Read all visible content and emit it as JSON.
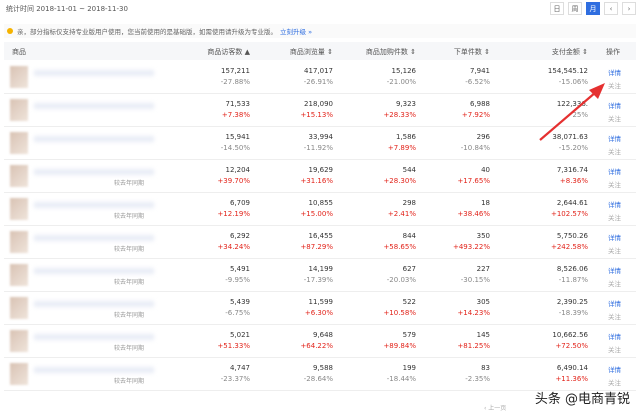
{
  "period": "统计时间 2018-11-01 ~ 2018-11-30",
  "period_tabs": [
    "日",
    "周",
    "月"
  ],
  "active_tab": "月",
  "notice": "亲，部分指标仅支持专业版用户使用，您当前使用的是基础版，如需使用请升级为专业版。",
  "notice_link": "立刻升级 »",
  "columns": [
    "商品",
    "商品访客数 ▲",
    "商品浏览量 ⇕",
    "商品加购件数 ⇕",
    "下单件数 ⇕",
    "支付金额 ⇕",
    "操作"
  ],
  "detail_label": "详情",
  "follow_label": "关注",
  "compare_label": "较去年同期",
  "rows": [
    {
      "cmp": "",
      "c": [
        [
          "157,211",
          "-27.88%"
        ],
        [
          "417,017",
          "-26.91%"
        ],
        [
          "15,126",
          "-21.00%"
        ],
        [
          "7,941",
          "-6.52%"
        ],
        [
          "154,545.12",
          "-15.06%"
        ]
      ]
    },
    {
      "cmp": "",
      "c": [
        [
          "71,533",
          "+7.38%"
        ],
        [
          "218,090",
          "+15.13%"
        ],
        [
          "9,323",
          "+28.33%"
        ],
        [
          "6,988",
          "+7.92%"
        ],
        [
          "122,336.",
          "25%"
        ]
      ]
    },
    {
      "cmp": "",
      "c": [
        [
          "15,941",
          "-14.50%"
        ],
        [
          "33,994",
          "-11.92%"
        ],
        [
          "1,586",
          "+7.89%"
        ],
        [
          "296",
          "-10.84%"
        ],
        [
          "38,071.63",
          "-15.20%"
        ]
      ]
    },
    {
      "cmp": "较去年同期",
      "c": [
        [
          "12,204",
          "+39.70%"
        ],
        [
          "19,629",
          "+31.16%"
        ],
        [
          "544",
          "+28.30%"
        ],
        [
          "40",
          "+17.65%"
        ],
        [
          "7,316.74",
          "+8.36%"
        ]
      ]
    },
    {
      "cmp": "较去年同期",
      "c": [
        [
          "6,709",
          "+12.19%"
        ],
        [
          "10,855",
          "+15.00%"
        ],
        [
          "298",
          "+2.41%"
        ],
        [
          "18",
          "+38.46%"
        ],
        [
          "2,644.61",
          "+102.57%"
        ]
      ]
    },
    {
      "cmp": "较去年同期",
      "c": [
        [
          "6,292",
          "+34.24%"
        ],
        [
          "16,455",
          "+87.29%"
        ],
        [
          "844",
          "+58.65%"
        ],
        [
          "350",
          "+493.22%"
        ],
        [
          "5,750.26",
          "+242.58%"
        ]
      ]
    },
    {
      "cmp": "较去年同期",
      "c": [
        [
          "5,491",
          "-9.95%"
        ],
        [
          "14,199",
          "-17.39%"
        ],
        [
          "627",
          "-20.03%"
        ],
        [
          "227",
          "-30.15%"
        ],
        [
          "8,526.06",
          "-11.87%"
        ]
      ]
    },
    {
      "cmp": "较去年同期",
      "c": [
        [
          "5,439",
          "-6.75%"
        ],
        [
          "11,599",
          "+6.30%"
        ],
        [
          "522",
          "+10.58%"
        ],
        [
          "305",
          "+14.23%"
        ],
        [
          "2,390.25",
          "-18.39%"
        ]
      ]
    },
    {
      "cmp": "较去年同期",
      "c": [
        [
          "5,021",
          "+51.33%"
        ],
        [
          "9,648",
          "+64.22%"
        ],
        [
          "579",
          "+89.84%"
        ],
        [
          "145",
          "+81.25%"
        ],
        [
          "10,662.56",
          "+72.50%"
        ]
      ]
    },
    {
      "cmp": "较去年同期",
      "c": [
        [
          "4,747",
          "-23.37%"
        ],
        [
          "9,588",
          "-28.64%"
        ],
        [
          "199",
          "-18.44%"
        ],
        [
          "83",
          "-2.35%"
        ],
        [
          "6,490.14",
          "+11.36%"
        ]
      ]
    }
  ],
  "pager_prev": "‹ 上一页",
  "watermark": "头条 @电商青锐"
}
